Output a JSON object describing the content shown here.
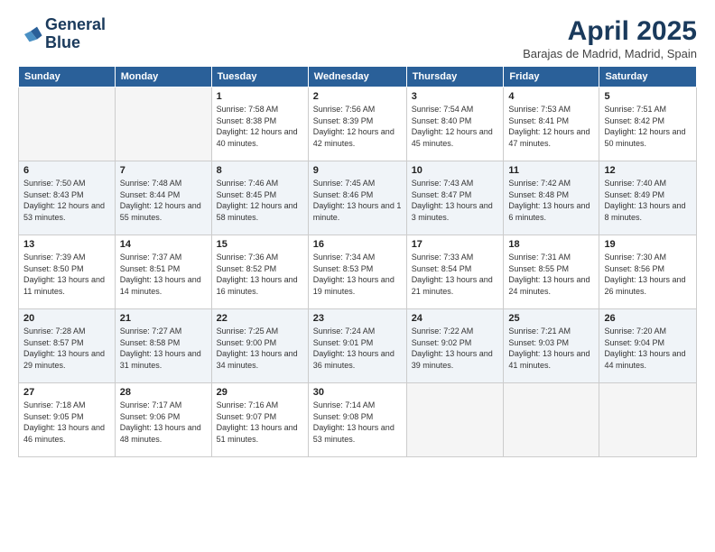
{
  "header": {
    "logo_line1": "General",
    "logo_line2": "Blue",
    "month": "April 2025",
    "location": "Barajas de Madrid, Madrid, Spain"
  },
  "weekdays": [
    "Sunday",
    "Monday",
    "Tuesday",
    "Wednesday",
    "Thursday",
    "Friday",
    "Saturday"
  ],
  "weeks": [
    [
      {
        "day": "",
        "info": ""
      },
      {
        "day": "",
        "info": ""
      },
      {
        "day": "1",
        "info": "Sunrise: 7:58 AM\nSunset: 8:38 PM\nDaylight: 12 hours and 40 minutes."
      },
      {
        "day": "2",
        "info": "Sunrise: 7:56 AM\nSunset: 8:39 PM\nDaylight: 12 hours and 42 minutes."
      },
      {
        "day": "3",
        "info": "Sunrise: 7:54 AM\nSunset: 8:40 PM\nDaylight: 12 hours and 45 minutes."
      },
      {
        "day": "4",
        "info": "Sunrise: 7:53 AM\nSunset: 8:41 PM\nDaylight: 12 hours and 47 minutes."
      },
      {
        "day": "5",
        "info": "Sunrise: 7:51 AM\nSunset: 8:42 PM\nDaylight: 12 hours and 50 minutes."
      }
    ],
    [
      {
        "day": "6",
        "info": "Sunrise: 7:50 AM\nSunset: 8:43 PM\nDaylight: 12 hours and 53 minutes."
      },
      {
        "day": "7",
        "info": "Sunrise: 7:48 AM\nSunset: 8:44 PM\nDaylight: 12 hours and 55 minutes."
      },
      {
        "day": "8",
        "info": "Sunrise: 7:46 AM\nSunset: 8:45 PM\nDaylight: 12 hours and 58 minutes."
      },
      {
        "day": "9",
        "info": "Sunrise: 7:45 AM\nSunset: 8:46 PM\nDaylight: 13 hours and 1 minute."
      },
      {
        "day": "10",
        "info": "Sunrise: 7:43 AM\nSunset: 8:47 PM\nDaylight: 13 hours and 3 minutes."
      },
      {
        "day": "11",
        "info": "Sunrise: 7:42 AM\nSunset: 8:48 PM\nDaylight: 13 hours and 6 minutes."
      },
      {
        "day": "12",
        "info": "Sunrise: 7:40 AM\nSunset: 8:49 PM\nDaylight: 13 hours and 8 minutes."
      }
    ],
    [
      {
        "day": "13",
        "info": "Sunrise: 7:39 AM\nSunset: 8:50 PM\nDaylight: 13 hours and 11 minutes."
      },
      {
        "day": "14",
        "info": "Sunrise: 7:37 AM\nSunset: 8:51 PM\nDaylight: 13 hours and 14 minutes."
      },
      {
        "day": "15",
        "info": "Sunrise: 7:36 AM\nSunset: 8:52 PM\nDaylight: 13 hours and 16 minutes."
      },
      {
        "day": "16",
        "info": "Sunrise: 7:34 AM\nSunset: 8:53 PM\nDaylight: 13 hours and 19 minutes."
      },
      {
        "day": "17",
        "info": "Sunrise: 7:33 AM\nSunset: 8:54 PM\nDaylight: 13 hours and 21 minutes."
      },
      {
        "day": "18",
        "info": "Sunrise: 7:31 AM\nSunset: 8:55 PM\nDaylight: 13 hours and 24 minutes."
      },
      {
        "day": "19",
        "info": "Sunrise: 7:30 AM\nSunset: 8:56 PM\nDaylight: 13 hours and 26 minutes."
      }
    ],
    [
      {
        "day": "20",
        "info": "Sunrise: 7:28 AM\nSunset: 8:57 PM\nDaylight: 13 hours and 29 minutes."
      },
      {
        "day": "21",
        "info": "Sunrise: 7:27 AM\nSunset: 8:58 PM\nDaylight: 13 hours and 31 minutes."
      },
      {
        "day": "22",
        "info": "Sunrise: 7:25 AM\nSunset: 9:00 PM\nDaylight: 13 hours and 34 minutes."
      },
      {
        "day": "23",
        "info": "Sunrise: 7:24 AM\nSunset: 9:01 PM\nDaylight: 13 hours and 36 minutes."
      },
      {
        "day": "24",
        "info": "Sunrise: 7:22 AM\nSunset: 9:02 PM\nDaylight: 13 hours and 39 minutes."
      },
      {
        "day": "25",
        "info": "Sunrise: 7:21 AM\nSunset: 9:03 PM\nDaylight: 13 hours and 41 minutes."
      },
      {
        "day": "26",
        "info": "Sunrise: 7:20 AM\nSunset: 9:04 PM\nDaylight: 13 hours and 44 minutes."
      }
    ],
    [
      {
        "day": "27",
        "info": "Sunrise: 7:18 AM\nSunset: 9:05 PM\nDaylight: 13 hours and 46 minutes."
      },
      {
        "day": "28",
        "info": "Sunrise: 7:17 AM\nSunset: 9:06 PM\nDaylight: 13 hours and 48 minutes."
      },
      {
        "day": "29",
        "info": "Sunrise: 7:16 AM\nSunset: 9:07 PM\nDaylight: 13 hours and 51 minutes."
      },
      {
        "day": "30",
        "info": "Sunrise: 7:14 AM\nSunset: 9:08 PM\nDaylight: 13 hours and 53 minutes."
      },
      {
        "day": "",
        "info": ""
      },
      {
        "day": "",
        "info": ""
      },
      {
        "day": "",
        "info": ""
      }
    ]
  ]
}
